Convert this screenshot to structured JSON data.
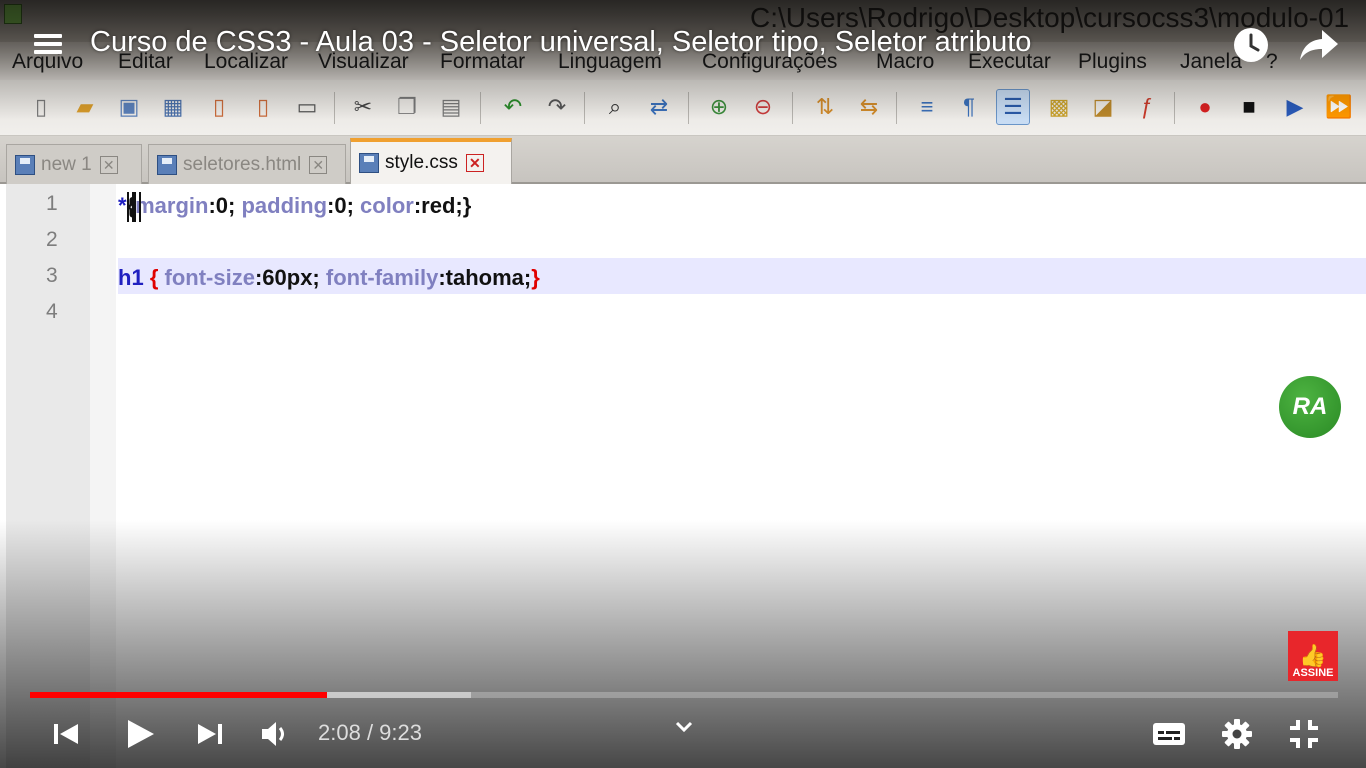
{
  "window": {
    "title_path": "C:\\Users\\Rodrigo\\Desktop\\cursocss3\\modulo-01"
  },
  "menubar": {
    "items": [
      "Arquivo",
      "Editar",
      "Localizar",
      "Visualizar",
      "Formatar",
      "Linguagem",
      "Configurações",
      "Macro",
      "Executar",
      "Plugins",
      "Janela",
      "?"
    ]
  },
  "tabs": [
    {
      "label": "new  1",
      "active": false
    },
    {
      "label": "seletores.html",
      "active": false
    },
    {
      "label": "style.css",
      "active": true
    }
  ],
  "editor": {
    "line_numbers": [
      "1",
      "2",
      "3",
      "4"
    ],
    "line1": {
      "sel": "*",
      "brace_open": "{",
      "p1": "margin",
      "v1": ":0; ",
      "p2": "padding",
      "v2": ":0; ",
      "p3": "color",
      "v3": ":red;",
      "brace_close": "}"
    },
    "line3": {
      "sel": "h1",
      "sp": " ",
      "brace_open": "{",
      "sp2": " ",
      "p1": "font-size",
      "v1": ":60px; ",
      "p2": "font-family",
      "v2": ":tahoma;",
      "brace_close": "}"
    }
  },
  "player": {
    "video_title": "Curso de CSS3 - Aula 03 - Seletor universal, Seletor tipo, Seletor atributo",
    "current_time": "2:08",
    "duration": "9:23",
    "time_separator": " / ",
    "progress_played": 0.227,
    "progress_buffered": 0.337,
    "watermark_text": "RA",
    "subscribe_label": "ASSINE",
    "accent_color": "#ff0000"
  },
  "icons": {
    "toolbar": [
      "new-file-icon",
      "open-file-icon",
      "save-icon",
      "save-all-icon",
      "close-icon",
      "close-all-icon",
      "print-icon",
      "cut-icon",
      "copy-icon",
      "paste-icon",
      "undo-icon",
      "redo-icon",
      "find-icon",
      "replace-icon",
      "zoom-in-icon",
      "zoom-out-icon",
      "sync-vertical-icon",
      "sync-horizontal-icon",
      "word-wrap-icon",
      "show-all-chars-icon",
      "indent-guide-icon",
      "user-lang-icon",
      "doc-map-icon",
      "function-list-icon",
      "record-macro-icon",
      "stop-macro-icon",
      "play-macro-icon",
      "run-macro-multiple-icon"
    ]
  }
}
